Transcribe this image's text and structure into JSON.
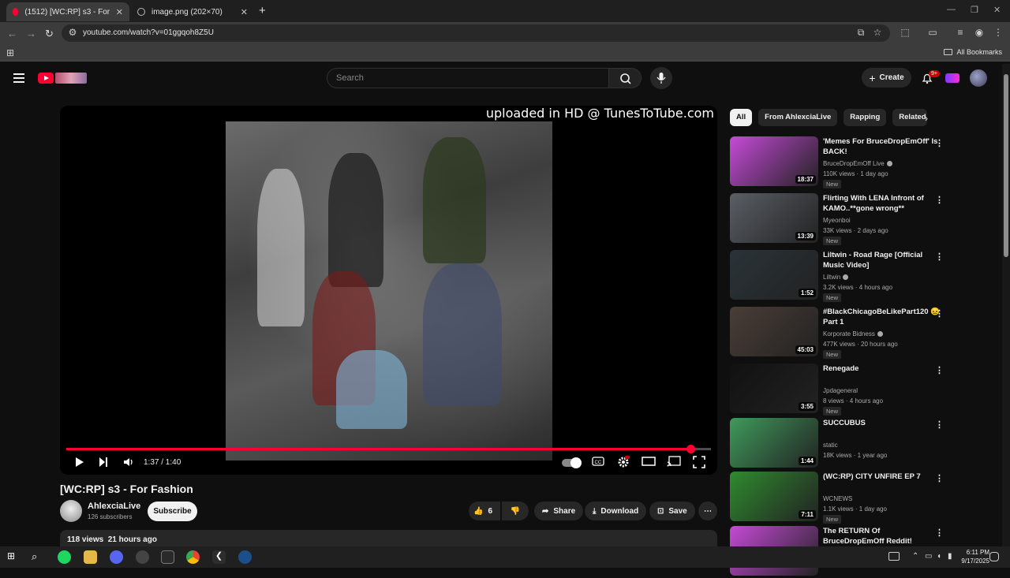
{
  "browser": {
    "tabs": [
      {
        "title": "(1512) [WC:RP] s3 - For Fashion",
        "active": true
      },
      {
        "title": "image.png (202×70)",
        "active": false
      }
    ],
    "url": "youtube.com/watch?v=01ggqoh8Z5U",
    "bookmarks_label": "All Bookmarks"
  },
  "youtube": {
    "search_placeholder": "Search",
    "create_label": "Create",
    "notifications_badge": "9+"
  },
  "player": {
    "watermark": "uploaded in HD @ TunesToTube.com",
    "time": "1:37 / 1:40",
    "progress_fraction": 0.97
  },
  "video": {
    "title": "[WC:RP] s3 - For Fashion",
    "channel": "AhlexciaLive",
    "subscribers": "126 subscribers",
    "subscribe_label": "Subscribe",
    "likes": "6",
    "share_label": "Share",
    "download_label": "Download",
    "save_label": "Save",
    "views": "118 views",
    "age": "21 hours ago"
  },
  "sidebar": {
    "chips": [
      "All",
      "From AhlexciaLive",
      "Rapping",
      "Related"
    ],
    "recommendations": [
      {
        "title": "'Memes For BruceDropEmOff' Is BACK!",
        "channel": "BruceDropEmOff Live",
        "verified": true,
        "meta": "110K views · 1 day ago",
        "badge": "New",
        "duration": "18:37",
        "thumb_color": "#c64ad8"
      },
      {
        "title": "Flirting With LENA Infront of KAMO..**gone wrong**",
        "channel": "Myeonboi",
        "verified": false,
        "meta": "33K views · 2 days ago",
        "badge": "New",
        "duration": "13:39",
        "thumb_color": "#5a5f66"
      },
      {
        "title": "Liltwin - Road Rage [Official Music Video]",
        "channel": "Liltwin",
        "verified": true,
        "meta": "3.2K views · 4 hours ago",
        "badge": "New",
        "duration": "1:52",
        "thumb_color": "#2a3338"
      },
      {
        "title": "#BlackChicagoBeLikePart120 😖Part 1",
        "channel": "Korporate Bidness",
        "verified": true,
        "meta": "477K views · 20 hours ago",
        "badge": "New",
        "duration": "45:03",
        "thumb_color": "#4a3d36"
      },
      {
        "title": "Renegade",
        "channel": "Jpdageneral",
        "verified": false,
        "meta": "8 views · 4 hours ago",
        "badge": "New",
        "duration": "3:55",
        "thumb_color": "#111111"
      },
      {
        "title": "SUCCUBUS",
        "channel": "static",
        "verified": false,
        "meta": "18K views · 1 year ago",
        "badge": "",
        "duration": "1:44",
        "thumb_color": "#3f9a5b"
      },
      {
        "title": "(WC:RP) CITY UNFIRE EP 7",
        "channel": "WCNEWS",
        "verified": false,
        "meta": "1.1K views · 1 day ago",
        "badge": "New",
        "duration": "7:11",
        "thumb_color": "#2f8a2f"
      },
      {
        "title": "The RETURN Of BruceDropEmOff Reddit!",
        "channel": "",
        "verified": false,
        "meta": "",
        "badge": "",
        "duration": "",
        "thumb_color": "#c64ad8"
      }
    ]
  },
  "taskbar": {
    "time": "6:11 PM",
    "date": "9/17/2025"
  }
}
